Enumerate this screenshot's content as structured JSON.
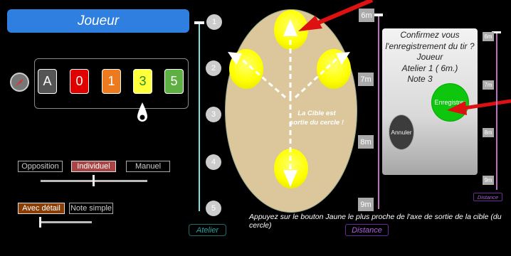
{
  "header": {
    "title": "Joueur"
  },
  "score": {
    "buttons": [
      {
        "label": "A",
        "color": "#555555"
      },
      {
        "label": "0",
        "color": "#e00000"
      },
      {
        "label": "1",
        "color": "#ee7a20"
      },
      {
        "label": "3",
        "color": "#ffff3a",
        "text_color": "#2b8a2b"
      },
      {
        "label": "5",
        "color": "#5fb043"
      }
    ],
    "compass_icon": "compass-icon",
    "selector_icon": "drop-pointer-icon"
  },
  "mode": {
    "options": [
      "Opposition",
      "Individuel",
      "Manuel"
    ],
    "selected": "Individuel",
    "selected_color": "#a84444"
  },
  "detail": {
    "options": [
      "Avec détail",
      "Note simple"
    ],
    "selected": "Avec détail",
    "selected_color": "#8a3e06"
  },
  "atelier": {
    "label": "Atelier",
    "markers": [
      "1",
      "2",
      "3",
      "4",
      "5"
    ],
    "line_color": "#7fdede"
  },
  "target": {
    "message_line1": "La Cible est",
    "message_line2": "sortie du cercle !",
    "circle_color": "#dcc79c",
    "zone_color": "#ffff00"
  },
  "distance": {
    "label": "Distance",
    "markers": [
      "6m",
      "7m",
      "8m",
      "9m"
    ],
    "line_color": "#c070c0"
  },
  "instruction": "Appuyez sur le bouton Jaune le plus proche de l'axe de sortie de la cible (du cercle)",
  "dialog": {
    "lines": [
      "Confirmez vous",
      "l'enregistrement du tir ?",
      "Joueur",
      "Atelier  1  ( 6m.)",
      "Note  3"
    ],
    "confirm_label": "Enregistrer",
    "cancel_label": "Annuler",
    "confirm_color": "#0dc60d"
  },
  "dialog_distance": {
    "label": "Distance",
    "markers": [
      "6m",
      "7m",
      "8m",
      "9m"
    ]
  },
  "annotations": {
    "arrow_color": "#d11"
  }
}
